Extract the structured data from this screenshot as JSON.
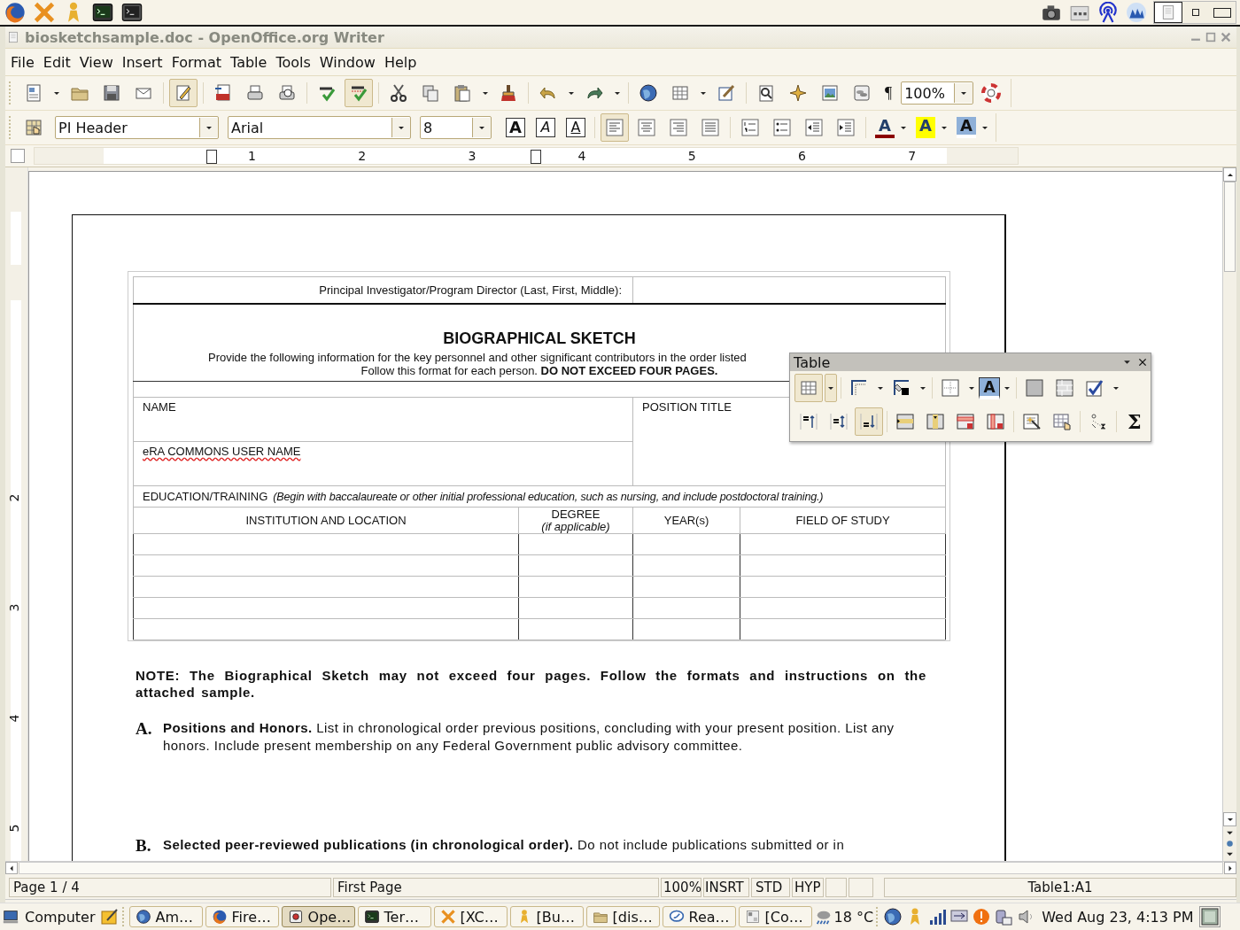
{
  "top_panel": {
    "workspaces": [
      {
        "selected": true
      },
      {
        "selected": false
      },
      {
        "selected": false
      }
    ]
  },
  "window": {
    "title": "biosketchsample.doc - OpenOffice.org Writer"
  },
  "menu": [
    {
      "label": "File"
    },
    {
      "label": "Edit"
    },
    {
      "label": "View"
    },
    {
      "label": "Insert"
    },
    {
      "label": "Format"
    },
    {
      "label": "Table"
    },
    {
      "label": "Tools"
    },
    {
      "label": "Window"
    },
    {
      "label": "Help"
    }
  ],
  "standard_toolbar": {
    "edit_mode_on": true,
    "autospellcheck_on": true,
    "pilcrow": "¶",
    "zoom": "100%"
  },
  "formatting_toolbar": {
    "paragraph_style": "PI Header",
    "font_name": "Arial",
    "font_size": "8",
    "char_buttons": [
      {
        "label": "A",
        "kind": "bold"
      },
      {
        "label": "A",
        "kind": "italic"
      },
      {
        "label": "A",
        "kind": "underline"
      }
    ],
    "color_buttons": [
      {
        "label": "A",
        "color": "#8b0000"
      },
      {
        "label": "A",
        "color": "#ffff00"
      },
      {
        "label": "A",
        "color": "#ffffff"
      }
    ]
  },
  "ruler": {
    "h_numbers": [
      "1",
      "2",
      "3",
      "4",
      "5",
      "6",
      "7"
    ],
    "v_numbers": [
      "2",
      "3",
      "4",
      "5"
    ]
  },
  "document": {
    "pi_label": "Principal Investigator/Program Director (Last, First, Middle):",
    "title": "BIOGRAPHICAL SKETCH",
    "instructions": [
      "Provide the following information for the key personnel and other significant contributors in the order listed",
      "Follow this format for each person.  **DO NOT EXCEED FOUR PAGES.**"
    ],
    "name_label": "NAME",
    "position_label": "POSITION TITLE",
    "era_label": "eRA COMMONS USER NAME",
    "education_label": "EDUCATION/TRAINING",
    "education_note": "(Begin with baccalaureate or other initial professional education, such as nursing, and include postdoctoral training.)",
    "columns": [
      {
        "label": "INSTITUTION AND LOCATION"
      },
      {
        "label": "DEGREE",
        "note": "(if applicable)"
      },
      {
        "label": "YEAR(s)"
      },
      {
        "label": "FIELD OF STUDY"
      }
    ],
    "note": "NOTE: The Biographical Sketch may not exceed four pages. Follow the formats and instructions on the attached sample.",
    "sections": [
      {
        "letter": "A.",
        "text": "**Positions and Honors.** List in chronological order previous positions, concluding with your present position. List any honors. Include present membership on any Federal Government public advisory committee."
      },
      {
        "letter": "B.",
        "text": "**Selected peer-reviewed publications (in chronological order).** Do not include publications submitted or in"
      }
    ]
  },
  "table_toolbar": {
    "title": "Table",
    "table_button_on": true,
    "bottom_align_on": true,
    "font_button": "A",
    "sum_button": "Σ"
  },
  "status_bar": {
    "page": "Page 1 / 4",
    "page_style": "First Page",
    "zoom": "100%",
    "insert_mode": "INSRT",
    "selection_mode": "STD",
    "hyphenation": "HYP",
    "cell": "Table1:A1"
  },
  "taskbar": {
    "menu": "Computer",
    "windows": [
      {
        "label": "Am…",
        "kind": "globe",
        "selected": false
      },
      {
        "label": "Fire…",
        "kind": "firefox",
        "selected": false
      },
      {
        "label": "Ope…",
        "kind": "office",
        "selected": true
      },
      {
        "label": "Ter…",
        "kind": "terminal",
        "selected": false
      },
      {
        "label": "[XC…",
        "kind": "xchat",
        "selected": false
      },
      {
        "label": "[Bu…",
        "kind": "buddy",
        "selected": false
      },
      {
        "label": "[dis…",
        "kind": "folder",
        "selected": false
      },
      {
        "label": "Rea…",
        "kind": "chat",
        "selected": false
      },
      {
        "label": "[Co…",
        "kind": "window",
        "selected": false
      }
    ],
    "weather": "18 °C",
    "clock": "Wed Aug 23,  4:13 PM"
  }
}
